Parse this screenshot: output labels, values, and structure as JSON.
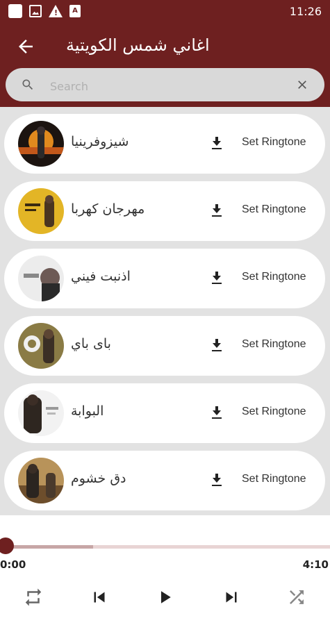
{
  "status_bar": {
    "time": "11:26",
    "icons": [
      "square-icon",
      "image-icon",
      "warning-icon",
      "a-letter-icon"
    ]
  },
  "app_bar": {
    "title": "اغاني شمس الكويتية",
    "back_icon": "arrow-left-icon"
  },
  "search": {
    "placeholder": "Search",
    "value": ""
  },
  "songs": [
    {
      "title": "شيزوفرينيا",
      "action": "Set Ringtone"
    },
    {
      "title": "مهرجان كهربا",
      "action": "Set Ringtone"
    },
    {
      "title": "اذنبت فيني",
      "action": "Set Ringtone"
    },
    {
      "title": "باى باي",
      "action": "Set Ringtone"
    },
    {
      "title": "البوابة",
      "action": "Set Ringtone"
    },
    {
      "title": "دق خشوم",
      "action": "Set Ringtone"
    }
  ],
  "player": {
    "current_time": "0:00",
    "total_time": "4:10",
    "progress_fraction": 0.0,
    "buffered_fraction": 0.27,
    "controls": [
      "repeat-icon",
      "skip-previous-icon",
      "play-icon",
      "skip-next-icon",
      "shuffle-icon"
    ]
  },
  "colors": {
    "brand": "#6e2020",
    "list_background": "#e2e2e2",
    "search_background": "#d9d9d9"
  }
}
